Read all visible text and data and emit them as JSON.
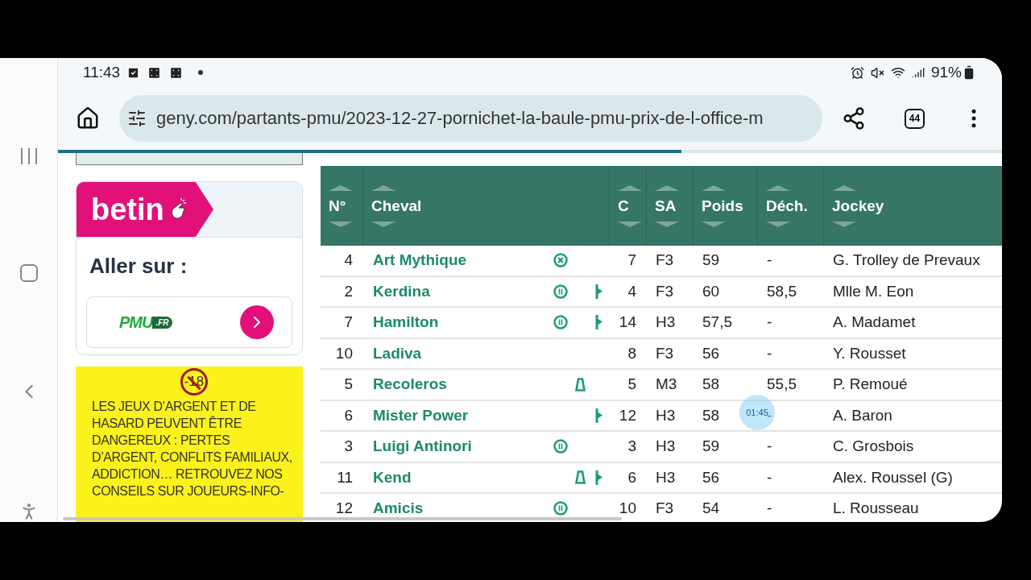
{
  "status_bar": {
    "time": "11:43",
    "battery": "91%"
  },
  "browser": {
    "url": "geny.com/partants-pmu/2023-12-27-pornichet-la-baule-pmu-prix-de-l-office-m",
    "tab_count": "44",
    "load_progress": {
      "level": 0.66
    }
  },
  "sidebar": {
    "brand": "betin",
    "heading": "Aller sur :",
    "partner": {
      "name": "PMU",
      "suffix": ".FR"
    },
    "warning": {
      "age_badge": "-18",
      "text": "LES JEUX D’ARGENT ET DE HASARD PEUVENT ÊTRE DANGEREUX : PERTES D’ARGENT, CONFLITS FAMILIAUX, ADDICTION… RETROUVEZ NOS CONSEILS SUR JOUEURS-INFO-"
    }
  },
  "table": {
    "columns": [
      "N°",
      "Cheval",
      "C",
      "SA",
      "Poids",
      "Déch.",
      "Jockey"
    ],
    "rows": [
      {
        "number": "4",
        "horse": "Art Mythique",
        "circle_x": true,
        "circle_bars": false,
        "triangle": false,
        "pennant": false,
        "c": "7",
        "sa": "F3",
        "weight": "59",
        "discharge": "-",
        "jockey": "G. Trolley de Prevaux"
      },
      {
        "number": "2",
        "horse": "Kerdina",
        "circle_x": false,
        "circle_bars": true,
        "triangle": false,
        "pennant": true,
        "c": "4",
        "sa": "F3",
        "weight": "60",
        "discharge": "58,5",
        "jockey": "Mlle M. Eon"
      },
      {
        "number": "7",
        "horse": "Hamilton",
        "circle_x": false,
        "circle_bars": true,
        "triangle": false,
        "pennant": true,
        "c": "14",
        "sa": "H3",
        "weight": "57,5",
        "discharge": "-",
        "jockey": "A. Madamet"
      },
      {
        "number": "10",
        "horse": "Ladiva",
        "circle_x": false,
        "circle_bars": false,
        "triangle": false,
        "pennant": false,
        "c": "8",
        "sa": "F3",
        "weight": "56",
        "discharge": "-",
        "jockey": "Y. Rousset"
      },
      {
        "number": "5",
        "horse": "Recoleros",
        "circle_x": false,
        "circle_bars": false,
        "triangle": true,
        "pennant": false,
        "c": "5",
        "sa": "M3",
        "weight": "58",
        "discharge": "55,5",
        "jockey": "P. Remoué"
      },
      {
        "number": "6",
        "horse": "Mister Power",
        "circle_x": false,
        "circle_bars": false,
        "triangle": false,
        "pennant": true,
        "c": "12",
        "sa": "H3",
        "weight": "58",
        "discharge": "-",
        "jockey": "A. Baron"
      },
      {
        "number": "3",
        "horse": "Luigi Antinori",
        "circle_x": false,
        "circle_bars": true,
        "triangle": false,
        "pennant": false,
        "c": "3",
        "sa": "H3",
        "weight": "59",
        "discharge": "-",
        "jockey": "C. Grosbois"
      },
      {
        "number": "11",
        "horse": "Kend",
        "circle_x": false,
        "circle_bars": false,
        "triangle": true,
        "pennant": true,
        "c": "6",
        "sa": "H3",
        "weight": "56",
        "discharge": "-",
        "jockey": "Alex. Roussel (G)"
      },
      {
        "number": "12",
        "horse": "Amicis",
        "circle_x": false,
        "circle_bars": true,
        "triangle": false,
        "pennant": false,
        "c": "10",
        "sa": "F3",
        "weight": "54",
        "discharge": "-",
        "jockey": "L. Rousseau"
      }
    ]
  },
  "touch_indicator": {
    "time": "01:45"
  }
}
